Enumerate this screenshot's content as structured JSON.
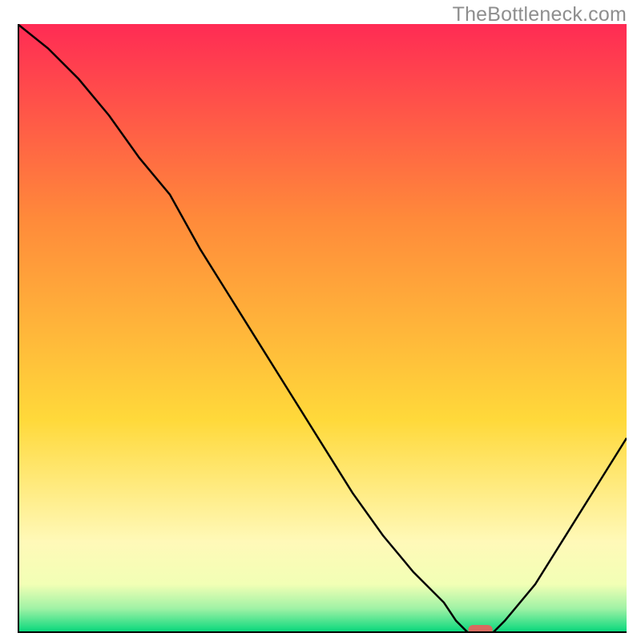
{
  "watermark": "TheBottleneck.com",
  "colors": {
    "gradient_top": "#ff2b54",
    "gradient_mid1": "#ff8a3a",
    "gradient_mid2": "#ffd93a",
    "gradient_band1": "#fff9b8",
    "gradient_band2": "#f2ffb5",
    "gradient_band3": "#9ff2a5",
    "gradient_bottom": "#00d67a",
    "marker": "#d86a5f"
  },
  "chart_data": {
    "type": "line",
    "title": "",
    "xlabel": "",
    "ylabel": "",
    "xlim": [
      0,
      100
    ],
    "ylim": [
      0,
      100
    ],
    "x": [
      0,
      5,
      10,
      15,
      20,
      25,
      30,
      35,
      40,
      45,
      50,
      55,
      60,
      65,
      70,
      72,
      74,
      76,
      78,
      80,
      85,
      90,
      95,
      100
    ],
    "values": [
      100,
      96,
      91,
      85,
      78,
      72,
      63,
      55,
      47,
      39,
      31,
      23,
      16,
      10,
      5,
      2,
      0,
      0,
      0,
      2,
      8,
      16,
      24,
      32
    ],
    "valley_marker": {
      "x_start": 74,
      "x_end": 78,
      "y": 0
    }
  }
}
